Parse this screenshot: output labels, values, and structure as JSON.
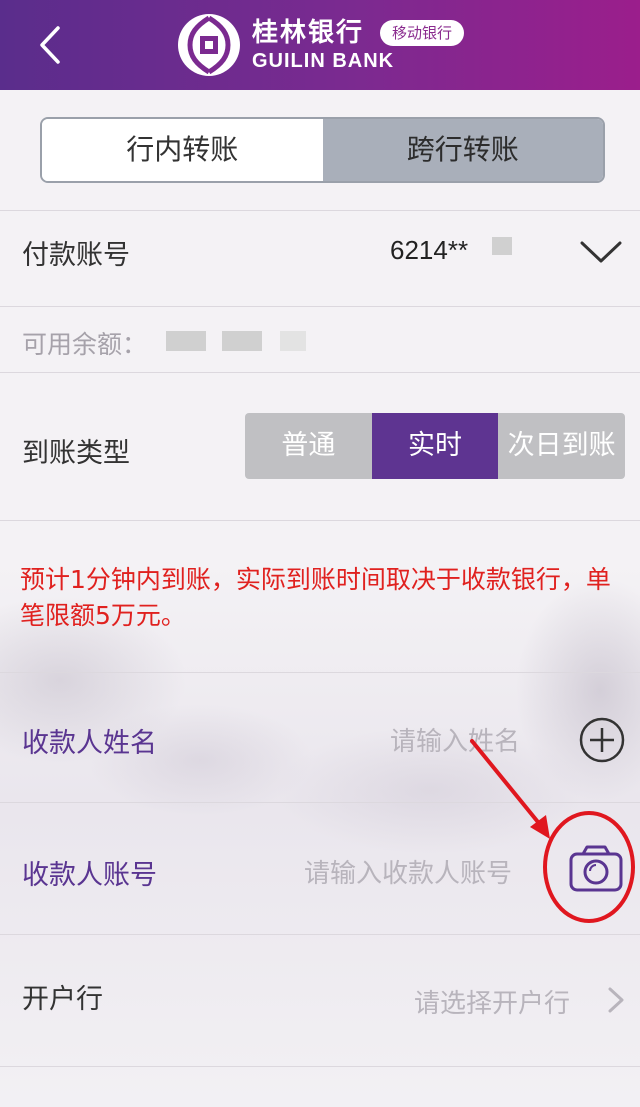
{
  "header": {
    "bank_name_cn": "桂林银行",
    "bank_name_en": "GUILIN BANK",
    "badge": "移动银行",
    "back_icon": "chevron-left-icon",
    "colors": {
      "start": "#5a2d8c",
      "end": "#9b1e8c"
    }
  },
  "transfer_tabs": [
    {
      "label": "行内转账",
      "selected": true
    },
    {
      "label": "跨行转账",
      "selected": false
    }
  ],
  "payment_account": {
    "label": "付款账号",
    "value": "6214**",
    "dropdown_icon": "chevron-down-icon"
  },
  "balance": {
    "label": "可用余额："
  },
  "arrival_type": {
    "label": "到账类型",
    "options": [
      "普通",
      "实时",
      "次日到账"
    ],
    "selected": "实时",
    "accent_color": "#5e3491"
  },
  "notice": "预计1分钟内到账，实际到账时间取决于收款银行，单笔限额5万元。",
  "payee_name": {
    "label": "收款人姓名",
    "placeholder": "请输入姓名",
    "icon": "plus-circle-icon"
  },
  "payee_account": {
    "label": "收款人账号",
    "placeholder": "请输入收款人账号",
    "icon": "camera-icon"
  },
  "bank": {
    "label": "开户行",
    "placeholder": "请选择开户行",
    "icon": "chevron-right-icon"
  }
}
